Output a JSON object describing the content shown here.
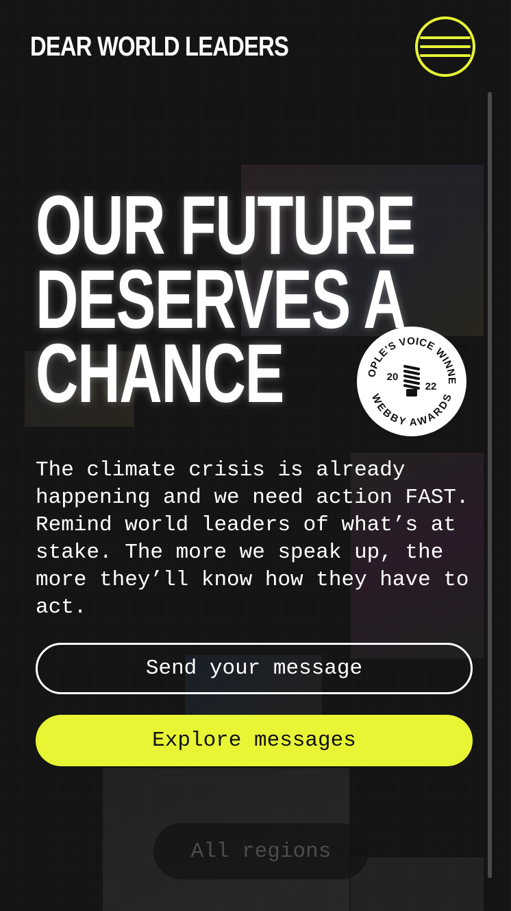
{
  "header": {
    "logo": "DEAR WORLD LEADERS",
    "menu_icon": "hamburger-menu-icon"
  },
  "hero": {
    "title_lines": [
      "OUR FUTURE",
      "DESERVES A",
      "CHANCE"
    ],
    "body": "The climate crisis is already happening and we need action FAST. Remind world leaders of what’s at stake. The more we speak up, the more they’ll know how they have to act."
  },
  "badge": {
    "top_text": "PEOPLE'S VOICE WINNER",
    "bottom_text": "WEBBY AWARDS",
    "year_left": "20",
    "year_right": "22",
    "icon": "webby-spring-trophy-icon"
  },
  "actions": {
    "send_label": "Send your message",
    "explore_label": "Explore messages"
  },
  "filter": {
    "region_label": "All regions"
  },
  "colors": {
    "accent": "#e7f535",
    "background": "#111111",
    "text": "#ffffff"
  }
}
